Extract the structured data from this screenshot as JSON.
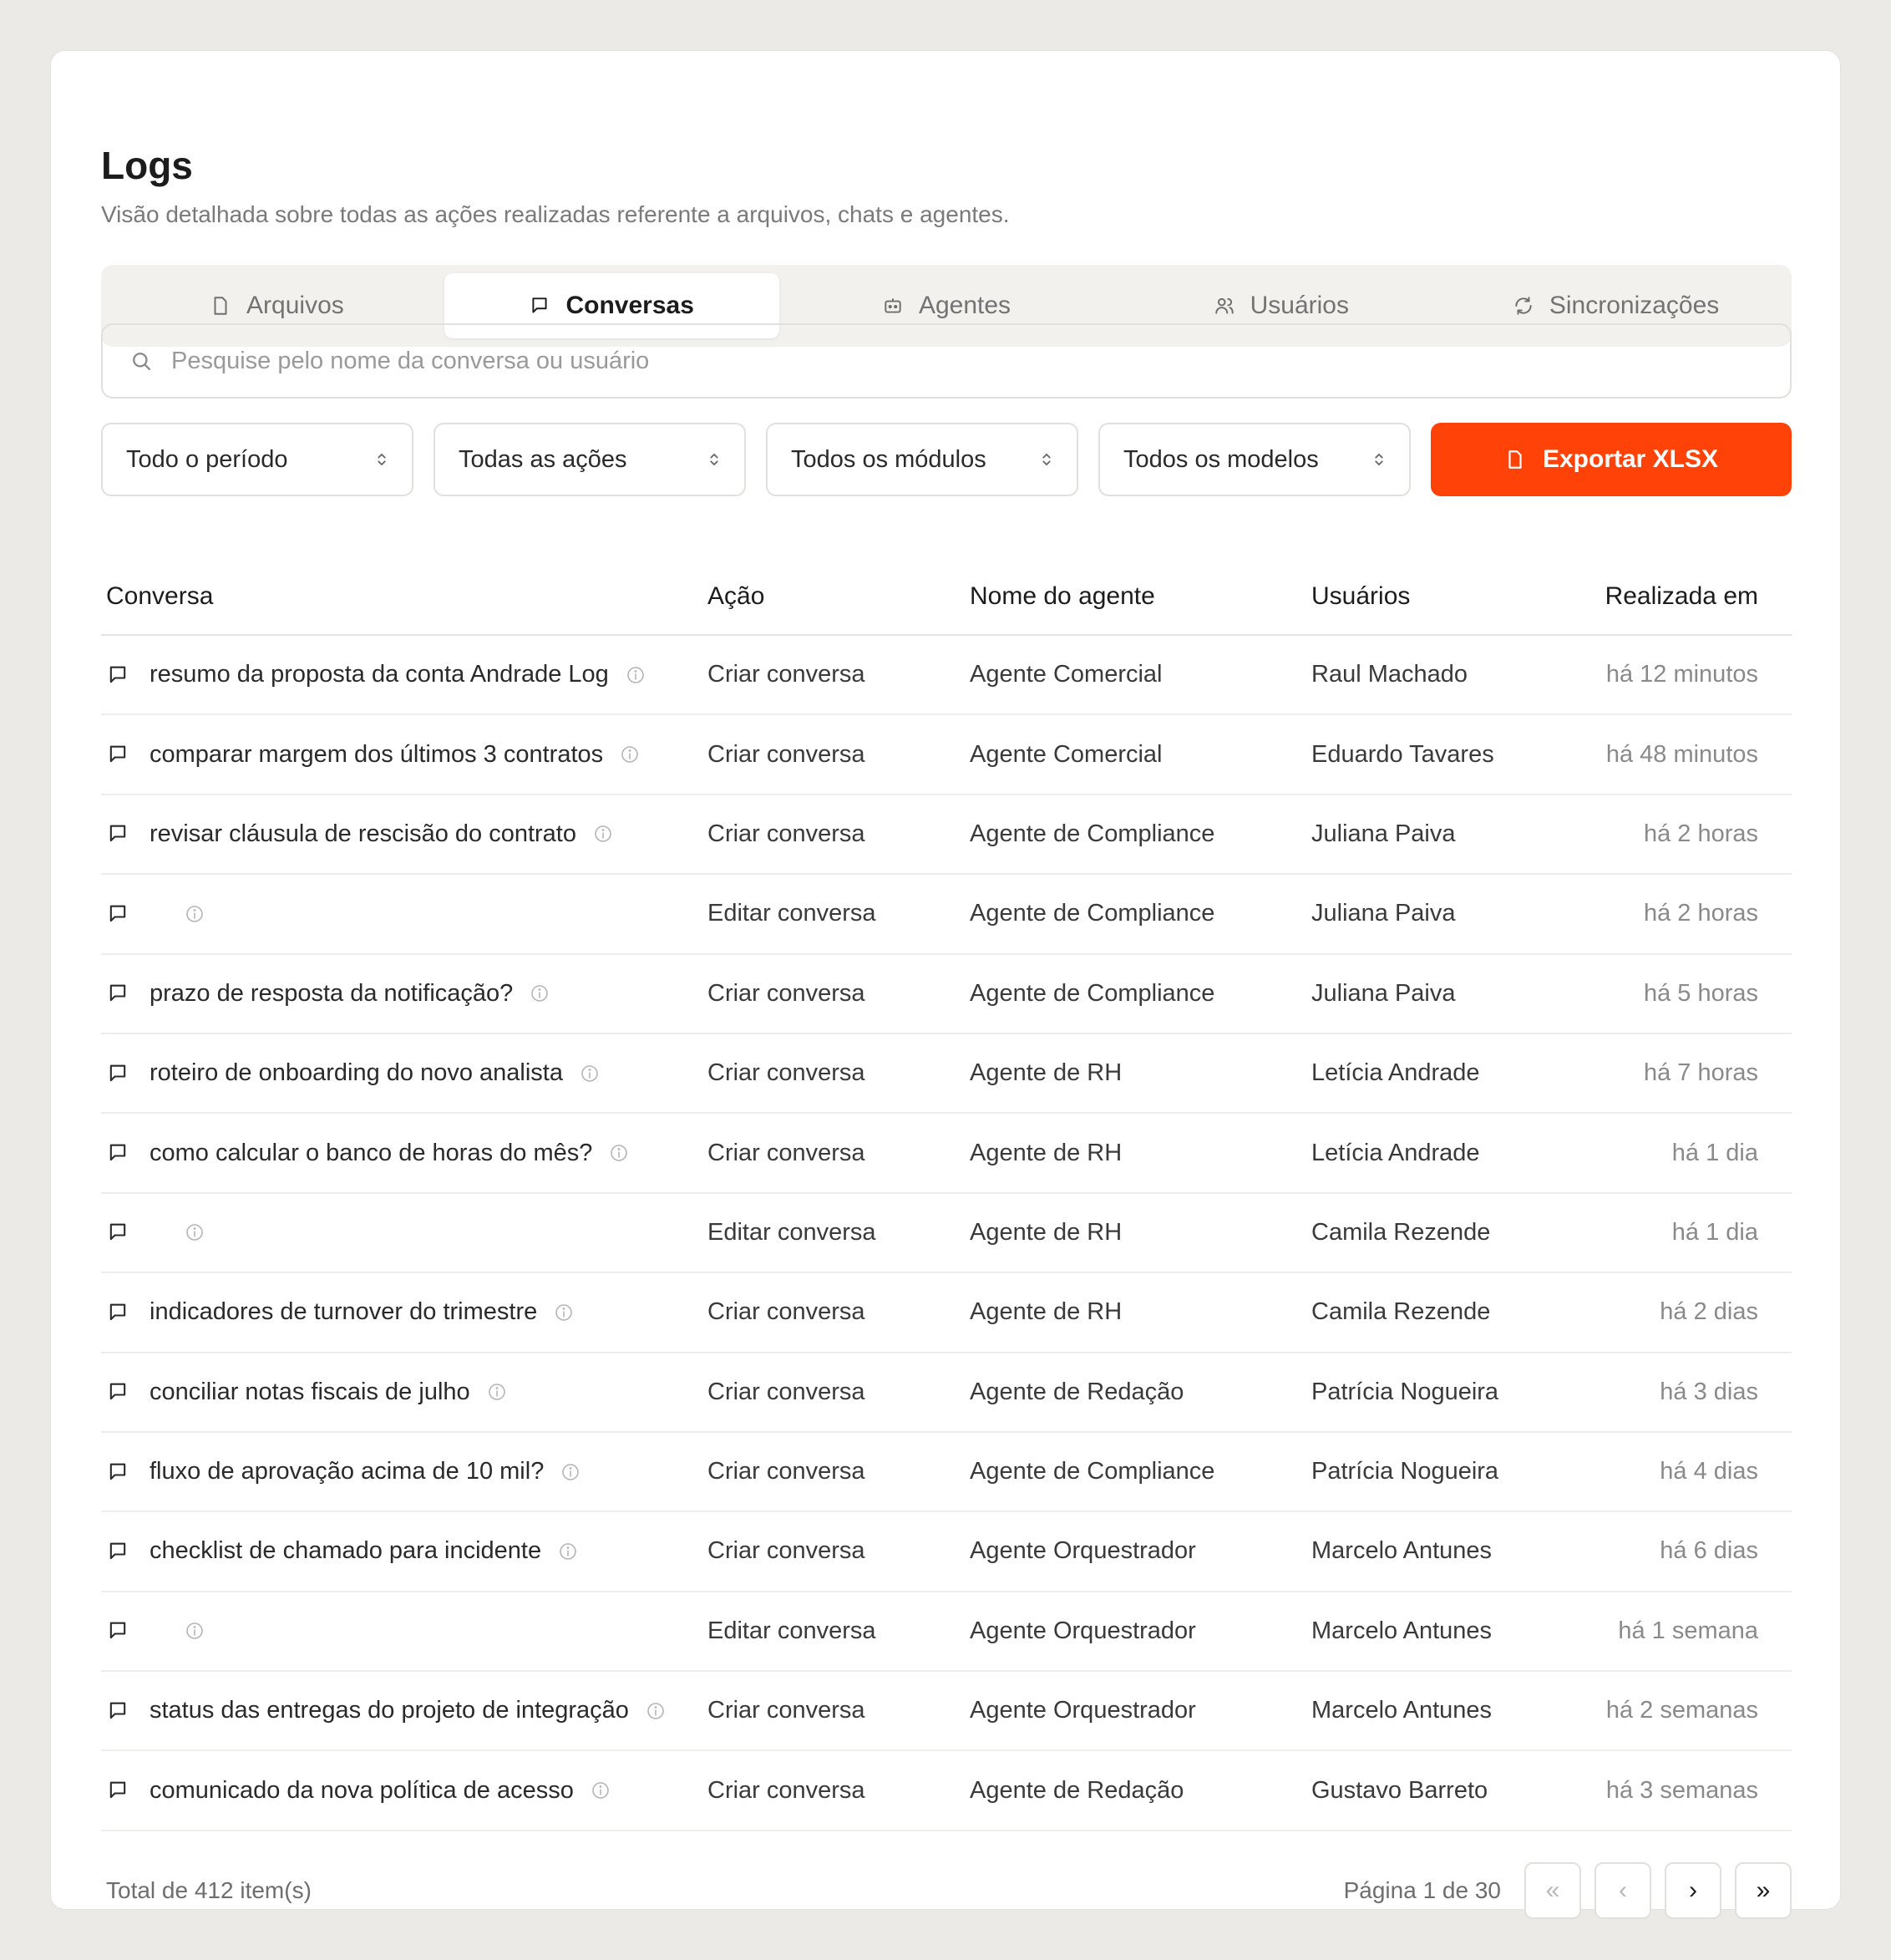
{
  "header": {
    "title": "Logs",
    "subtitle": "Visão detalhada sobre todas as ações realizadas referente a arquivos, chats e agentes."
  },
  "tabs": [
    {
      "label": "Arquivos",
      "icon": "file-icon",
      "active": false
    },
    {
      "label": "Conversas",
      "icon": "chat-icon",
      "active": true
    },
    {
      "label": "Agentes",
      "icon": "bot-icon",
      "active": false
    },
    {
      "label": "Usuários",
      "icon": "users-icon",
      "active": false
    },
    {
      "label": "Sincronizações",
      "icon": "sync-icon",
      "active": false
    }
  ],
  "search": {
    "placeholder": "Pesquise pelo nome da conversa ou usuário",
    "value": ""
  },
  "filters": {
    "period": "Todo o período",
    "actions": "Todas as ações",
    "modules": "Todos os módulos",
    "models": "Todos os modelos",
    "export_label": "Exportar XLSX"
  },
  "colors": {
    "accent": "#ff4207",
    "background": "#ebeae6"
  },
  "table": {
    "columns": [
      "Conversa",
      "Ação",
      "Nome do agente",
      "Usuários",
      "Realizada em"
    ],
    "rows": [
      {
        "conversa": "resumo da proposta da conta Andrade Log",
        "acao": "Criar conversa",
        "agente": "Agente Comercial",
        "usuario": "Raul Machado",
        "quando": "há 12 minutos"
      },
      {
        "conversa": "comparar margem dos últimos 3 contratos",
        "acao": "Criar conversa",
        "agente": "Agente Comercial",
        "usuario": "Eduardo Tavares",
        "quando": "há 48 minutos"
      },
      {
        "conversa": "revisar cláusula de rescisão do contrato",
        "acao": "Criar conversa",
        "agente": "Agente de Compliance",
        "usuario": "Juliana Paiva",
        "quando": "há 2 horas"
      },
      {
        "conversa": "",
        "acao": "Editar conversa",
        "agente": "Agente de Compliance",
        "usuario": "Juliana Paiva",
        "quando": "há 2 horas"
      },
      {
        "conversa": "prazo de resposta da notificação?",
        "acao": "Criar conversa",
        "agente": "Agente de Compliance",
        "usuario": "Juliana Paiva",
        "quando": "há 5 horas"
      },
      {
        "conversa": "roteiro de onboarding do novo analista",
        "acao": "Criar conversa",
        "agente": "Agente de RH",
        "usuario": "Letícia Andrade",
        "quando": "há 7 horas"
      },
      {
        "conversa": "como calcular o banco de horas do mês?",
        "acao": "Criar conversa",
        "agente": "Agente de RH",
        "usuario": "Letícia Andrade",
        "quando": "há 1 dia"
      },
      {
        "conversa": "",
        "acao": "Editar conversa",
        "agente": "Agente de RH",
        "usuario": "Camila Rezende",
        "quando": "há 1 dia"
      },
      {
        "conversa": "indicadores de turnover do trimestre",
        "acao": "Criar conversa",
        "agente": "Agente de RH",
        "usuario": "Camila Rezende",
        "quando": "há 2 dias"
      },
      {
        "conversa": "conciliar notas fiscais de julho",
        "acao": "Criar conversa",
        "agente": "Agente de Redação",
        "usuario": "Patrícia Nogueira",
        "quando": "há 3 dias"
      },
      {
        "conversa": "fluxo de aprovação acima de 10 mil?",
        "acao": "Criar conversa",
        "agente": "Agente de Compliance",
        "usuario": "Patrícia Nogueira",
        "quando": "há 4 dias"
      },
      {
        "conversa": "checklist de chamado para incidente",
        "acao": "Criar conversa",
        "agente": "Agente Orquestrador",
        "usuario": "Marcelo Antunes",
        "quando": "há 6 dias"
      },
      {
        "conversa": "",
        "acao": "Editar conversa",
        "agente": "Agente Orquestrador",
        "usuario": "Marcelo Antunes",
        "quando": "há 1 semana"
      },
      {
        "conversa": "status das entregas do projeto de integração",
        "acao": "Criar conversa",
        "agente": "Agente Orquestrador",
        "usuario": "Marcelo Antunes",
        "quando": "há 2 semanas"
      },
      {
        "conversa": "comunicado da nova política de acesso",
        "acao": "Criar conversa",
        "agente": "Agente de Redação",
        "usuario": "Gustavo Barreto",
        "quando": "há 3 semanas"
      }
    ]
  },
  "footer": {
    "total": "Total de 412 item(s)",
    "page_info": "Página 1 de 30",
    "first": "«",
    "prev": "‹",
    "next": "›",
    "last": "»"
  }
}
